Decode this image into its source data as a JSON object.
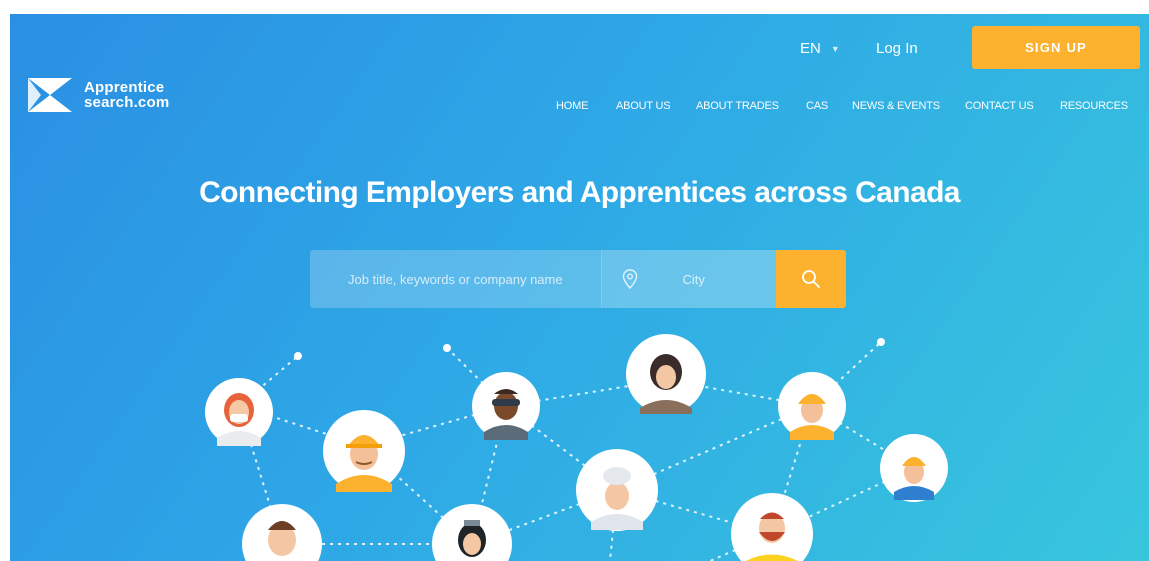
{
  "brand": {
    "line1": "Apprentice",
    "line2": "search.com"
  },
  "header": {
    "language": "EN",
    "login_label": "Log In",
    "signup_label": "SIGN UP"
  },
  "nav": {
    "home": "HOME",
    "about_us": "ABOUT US",
    "about_trades": "ABOUT TRADES",
    "cas": "CAS",
    "news_events": "NEWS & EVENTS",
    "contact_us": "CONTACT US",
    "resources": "RESOURCES"
  },
  "hero": {
    "headline": "Connecting Employers and Apprentices across Canada"
  },
  "search": {
    "keywords_placeholder": "Job title, keywords or company name",
    "city_placeholder": "City"
  },
  "colors": {
    "accent": "#fcb22e",
    "gradient_start": "#2a8fe3",
    "gradient_end": "#38c6dd"
  },
  "icons": {
    "logo": "apprenticesearch-logo",
    "location": "location-pin-icon",
    "search": "search-icon",
    "caret": "caret-down-icon"
  },
  "people": [
    "doctor",
    "construction-worker",
    "mechanic",
    "chef-barista",
    "chef",
    "welder",
    "electrician",
    "surgeon",
    "professional",
    "student"
  ]
}
